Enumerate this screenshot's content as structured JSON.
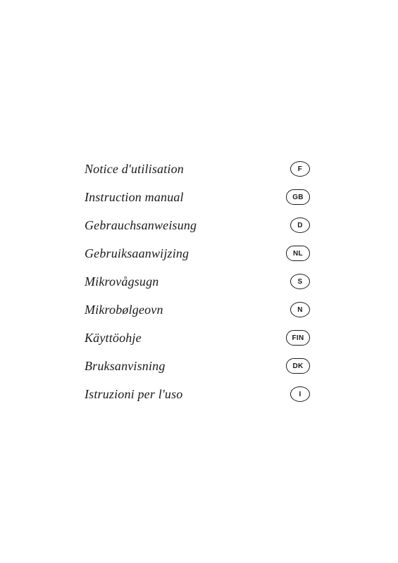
{
  "languages": [
    {
      "label": "Notice d'utilisation",
      "badge": "F",
      "wide": false
    },
    {
      "label": "Instruction manual",
      "badge": "GB",
      "wide": true
    },
    {
      "label": "Gebrauchsanweisung",
      "badge": "D",
      "wide": false
    },
    {
      "label": "Gebruiksaanwijzing",
      "badge": "NL",
      "wide": true
    },
    {
      "label": "Mikrovågsugn",
      "badge": "S",
      "wide": false
    },
    {
      "label": "Mikrobølgeovn",
      "badge": "N",
      "wide": false
    },
    {
      "label": "Käyttöohje",
      "badge": "FIN",
      "wide": true
    },
    {
      "label": "Bruksanvisning",
      "badge": "DK",
      "wide": true
    },
    {
      "label": "Istruzioni per l'uso",
      "badge": "I",
      "wide": false
    }
  ]
}
